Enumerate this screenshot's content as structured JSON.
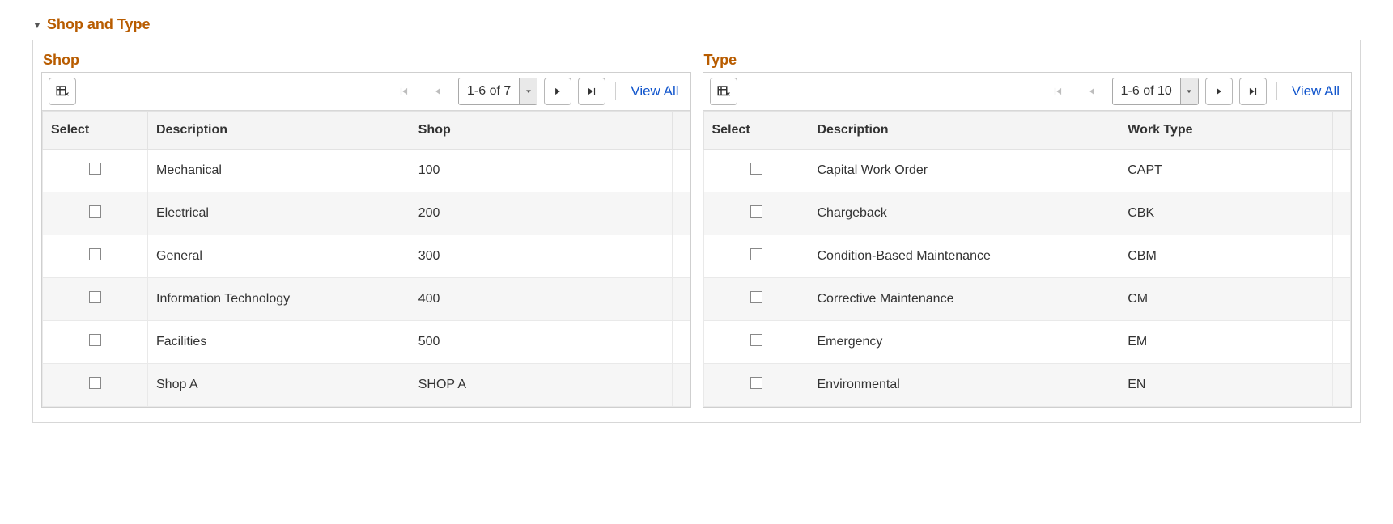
{
  "section_title": "Shop and Type",
  "shop": {
    "title": "Shop",
    "range": "1-6 of 7",
    "view_all": "View All",
    "headers": {
      "select": "Select",
      "desc": "Description",
      "code": "Shop"
    },
    "rows": [
      {
        "desc": "Mechanical",
        "code": "100"
      },
      {
        "desc": "Electrical",
        "code": "200"
      },
      {
        "desc": "General",
        "code": "300"
      },
      {
        "desc": "Information Technology",
        "code": "400"
      },
      {
        "desc": "Facilities",
        "code": "500"
      },
      {
        "desc": "Shop A",
        "code": "SHOP A"
      }
    ]
  },
  "type": {
    "title": "Type",
    "range": "1-6 of 10",
    "view_all": "View All",
    "headers": {
      "select": "Select",
      "desc": "Description",
      "code": "Work Type"
    },
    "rows": [
      {
        "desc": "Capital Work Order",
        "code": "CAPT"
      },
      {
        "desc": "Chargeback",
        "code": "CBK"
      },
      {
        "desc": "Condition-Based Maintenance",
        "code": "CBM"
      },
      {
        "desc": "Corrective Maintenance",
        "code": "CM"
      },
      {
        "desc": "Emergency",
        "code": "EM"
      },
      {
        "desc": "Environmental",
        "code": "EN"
      }
    ]
  }
}
